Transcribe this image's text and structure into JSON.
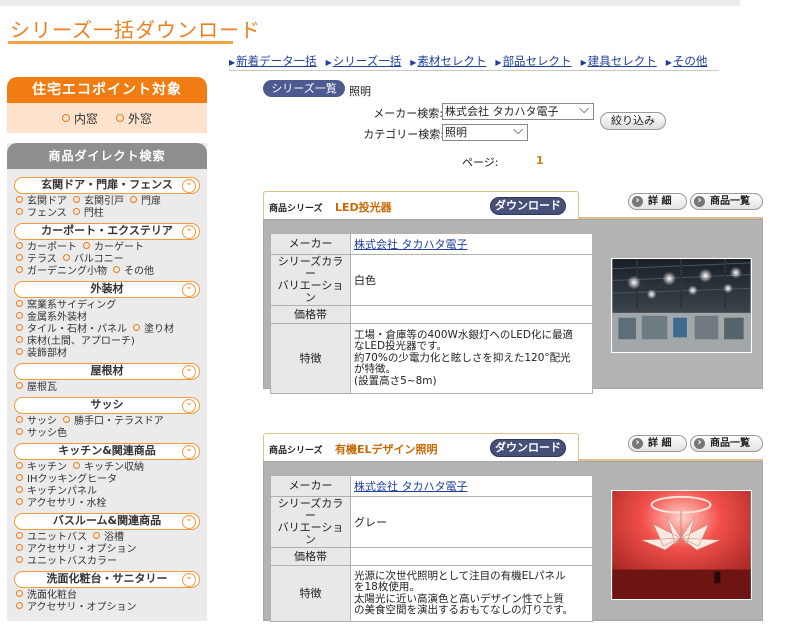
{
  "page": {
    "title": "シリーズ一括ダウンロード"
  },
  "top_nav": [
    "新着データ一括",
    "シリーズ一括",
    "素材セレクト",
    "部品セレクト",
    "建具セレクト",
    "その他"
  ],
  "sidebar": {
    "eco": {
      "title": "住宅エコポイント対象",
      "links": [
        "内窓",
        "外窓"
      ]
    },
    "search": {
      "title": "商品ダイレクト検索"
    },
    "categories": [
      {
        "name": "玄関ドア・門扉・フェンス",
        "rows": [
          [
            "玄関ドア",
            "玄関引戸",
            "門扉"
          ],
          [
            "フェンス",
            "門柱"
          ]
        ]
      },
      {
        "name": "カーポート・エクステリア",
        "rows": [
          [
            "カーポート",
            "カーゲート"
          ],
          [
            "テラス",
            "バルコニー"
          ],
          [
            "ガーデニング小物",
            "その他"
          ]
        ]
      },
      {
        "name": "外装材",
        "rows": [
          [
            "窯業系サイディング"
          ],
          [
            "金属系外装材"
          ],
          [
            "タイル・石材・パネル",
            "塗り材"
          ],
          [
            "床材(土間、アプローチ)"
          ],
          [
            "装飾部材"
          ]
        ]
      },
      {
        "name": "屋根材",
        "rows": [
          [
            "屋根瓦"
          ]
        ]
      },
      {
        "name": "サッシ",
        "rows": [
          [
            "サッシ",
            "勝手口・テラスドア"
          ],
          [
            "サッシ色"
          ]
        ]
      },
      {
        "name": "キッチン&関連商品",
        "rows": [
          [
            "キッチン",
            "キッチン収納"
          ],
          [
            "IHクッキングヒータ"
          ],
          [
            "キッチンパネル"
          ],
          [
            "アクセサリ・水栓"
          ]
        ]
      },
      {
        "name": "バスルーム&関連商品",
        "rows": [
          [
            "ユニットバス",
            "浴槽"
          ],
          [
            "アクセサリ・オプション"
          ],
          [
            "ユニットバスカラー"
          ]
        ]
      },
      {
        "name": "洗面化粧台・サニタリー",
        "rows": [
          [
            "洗面化粧台"
          ],
          [
            "アクセサリ・オプション"
          ]
        ]
      }
    ]
  },
  "main": {
    "series_list_label": "シリーズ一覧",
    "current": "照明",
    "maker_label": "メーカー検索:",
    "maker_value": "株式会社 タカハタ電子",
    "category_label": "カテゴリー検索:",
    "category_value": "照明",
    "filter_button": "絞り込み",
    "page_label": "ページ:",
    "page_value": "1",
    "cards": [
      {
        "kind": "商品シリーズ",
        "name": "LED投光器",
        "download": "ダウンロード",
        "detail": "詳 細",
        "list": "商品一覧",
        "rows": {
          "maker_key": "メーカー",
          "maker_val": "株式会社 タカハタ電子",
          "color_key1": "シリーズカラー",
          "color_key2": "バリエーション",
          "color_val": "白色",
          "price_key": "価格帯",
          "price_val": "",
          "feature_key": "特徴",
          "feature_lines": [
            "工場・倉庫等の400W水銀灯へのLED化に最適",
            "なLED投光器です。",
            "約70%の少電力化と眩しさを抑えた120°配光",
            "が特徴。",
            "(設置高さ5~8m)"
          ]
        }
      },
      {
        "kind": "商品シリーズ",
        "name": "有機ELデザイン照明",
        "download": "ダウンロード",
        "detail": "詳 細",
        "list": "商品一覧",
        "rows": {
          "maker_key": "メーカー",
          "maker_val": "株式会社 タカハタ電子",
          "color_key1": "シリーズカラー",
          "color_key2": "バリエーション",
          "color_val": "グレー",
          "price_key": "価格帯",
          "price_val": "",
          "feature_key": "特徴",
          "feature_lines": [
            "光源に次世代照明として注目の有機ELパネル",
            "を18枚使用。",
            "太陽光に近い高演色と高いデザイン性で上質",
            "の美食空間を演出するおもてなしの灯りです。"
          ]
        }
      }
    ]
  },
  "colors": {
    "accent": "#ee7f1f",
    "button_dark": "#465078",
    "link": "#1f3f9e"
  }
}
